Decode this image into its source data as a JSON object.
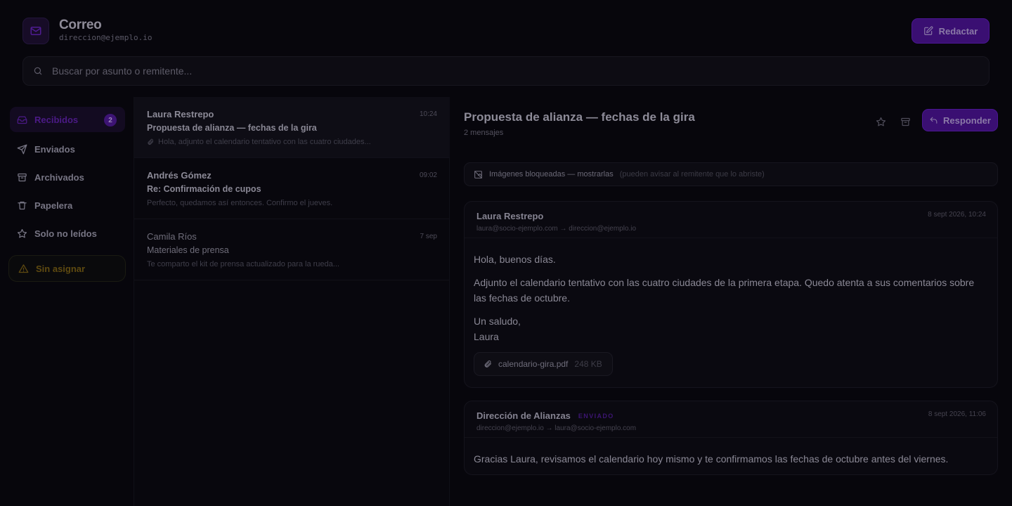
{
  "app": {
    "title": "Correo",
    "email": "direccion@ejemplo.io",
    "compose_label": "Redactar"
  },
  "search": {
    "placeholder": "Buscar por asunto o remitente..."
  },
  "sidebar": {
    "items": [
      {
        "label": "Recibidos",
        "icon": "inbox-icon",
        "badge": "2",
        "active": true
      },
      {
        "label": "Enviados",
        "icon": "send-icon"
      },
      {
        "label": "Archivados",
        "icon": "archive-icon"
      },
      {
        "label": "Papelera",
        "icon": "trash-icon"
      },
      {
        "label": "Solo no leídos",
        "icon": "star-icon"
      }
    ],
    "unassigned_label": "Sin asignar"
  },
  "messages": [
    {
      "from": "Laura Restrepo",
      "time": "10:24",
      "subject": "Propuesta de alianza — fechas de la gira",
      "preview": "Hola, adjunto el calendario tentativo con las cuatro ciudades...",
      "has_attachment": true,
      "unread": true,
      "selected": true
    },
    {
      "from": "Andrés Gómez",
      "time": "09:02",
      "subject": "Re: Confirmación de cupos",
      "preview": "Perfecto, quedamos así entonces. Confirmo el jueves.",
      "has_attachment": false,
      "unread": true
    },
    {
      "from": "Camila Ríos",
      "time": "7 sep",
      "subject": "Materiales de prensa",
      "preview": "Te comparto el kit de prensa actualizado para la rueda...",
      "has_attachment": false,
      "unread": false
    }
  ],
  "thread": {
    "title": "Propuesta de alianza — fechas de la gira",
    "count": "2 mensajes",
    "reply_label": "Responder",
    "blocked_text": "Imágenes bloqueadas — mostrarlas",
    "blocked_hint": "(pueden avisar al remitente que lo abriste)",
    "messages": [
      {
        "sender": "Laura Restrepo",
        "route": "laura@socio-ejemplo.com → direccion@ejemplo.io",
        "date": "8 sept 2026, 10:24",
        "p1": "Hola, buenos días.",
        "p2": "Adjunto el calendario tentativo con las cuatro ciudades de la primera etapa. Quedo atenta a sus comentarios sobre las fechas de octubre.",
        "p3_line1": "Un saludo,",
        "p3_line2": "Laura",
        "attachment_name": "calendario-gira.pdf",
        "attachment_size": "248 KB"
      },
      {
        "sender": "Dirección de Alianzas",
        "tag": "ENVIADO",
        "route": "direccion@ejemplo.io → laura@socio-ejemplo.com",
        "date": "8 sept 2026, 11:06",
        "p1": "Gracias Laura, revisamos el calendario hoy mismo y te confirmamos las fechas de octubre antes del viernes."
      }
    ]
  },
  "colors": {
    "accent": "#3a0f72",
    "accent_text": "#4b1a86",
    "warning": "#5f4a10",
    "background": "#07060c"
  }
}
